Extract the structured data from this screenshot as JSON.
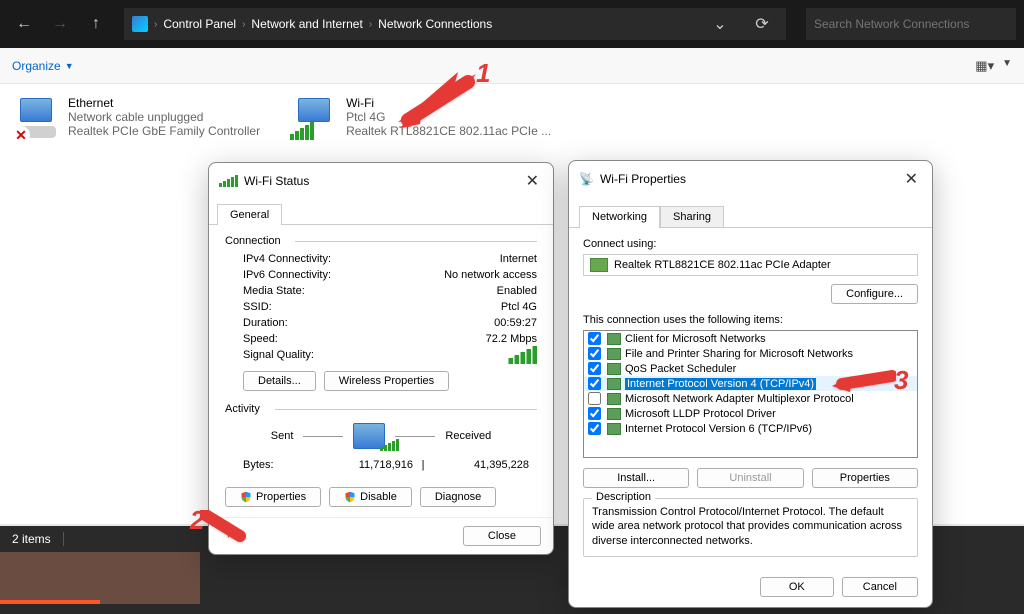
{
  "breadcrumbs": [
    "Control Panel",
    "Network and Internet",
    "Network Connections"
  ],
  "search_placeholder": "Search Network Connections",
  "toolbar": {
    "organize": "Organize"
  },
  "adapters": {
    "ethernet": {
      "name": "Ethernet",
      "status": "Network cable unplugged",
      "device": "Realtek PCIe GbE Family Controller"
    },
    "wifi": {
      "name": "Wi-Fi",
      "status": "Ptcl 4G",
      "device": "Realtek RTL8821CE 802.11ac PCIe ..."
    }
  },
  "annotations": {
    "a1": "1",
    "a2": "2",
    "a3": "3"
  },
  "status_bar": {
    "count": "2 items"
  },
  "status_dialog": {
    "title": "Wi-Fi Status",
    "tab_general": "General",
    "group_connection": "Connection",
    "group_activity": "Activity",
    "rows": {
      "ipv4_l": "IPv4 Connectivity:",
      "ipv4_v": "Internet",
      "ipv6_l": "IPv6 Connectivity:",
      "ipv6_v": "No network access",
      "media_l": "Media State:",
      "media_v": "Enabled",
      "ssid_l": "SSID:",
      "ssid_v": "Ptcl 4G",
      "dur_l": "Duration:",
      "dur_v": "00:59:27",
      "speed_l": "Speed:",
      "speed_v": "72.2 Mbps",
      "signal_l": "Signal Quality:"
    },
    "buttons": {
      "details": "Details...",
      "wprops": "Wireless Properties"
    },
    "activity": {
      "sent": "Sent",
      "received": "Received",
      "bytes_l": "Bytes:",
      "bytes_sent": "11,718,916",
      "bytes_recv": "41,395,228"
    },
    "footer": {
      "props": "Properties",
      "disable": "Disable",
      "diagnose": "Diagnose",
      "close": "Close"
    }
  },
  "props_dialog": {
    "title": "Wi-Fi Properties",
    "tab_networking": "Networking",
    "tab_sharing": "Sharing",
    "connect_using": "Connect using:",
    "adapter": "Realtek RTL8821CE 802.11ac PCIe Adapter",
    "configure": "Configure...",
    "items_label": "This connection uses the following items:",
    "items": [
      {
        "checked": true,
        "text": "Client for Microsoft Networks"
      },
      {
        "checked": true,
        "text": "File and Printer Sharing for Microsoft Networks"
      },
      {
        "checked": true,
        "text": "QoS Packet Scheduler"
      },
      {
        "checked": true,
        "text": "Internet Protocol Version 4 (TCP/IPv4)",
        "selected": true
      },
      {
        "checked": false,
        "text": "Microsoft Network Adapter Multiplexor Protocol"
      },
      {
        "checked": true,
        "text": "Microsoft LLDP Protocol Driver"
      },
      {
        "checked": true,
        "text": "Internet Protocol Version 6 (TCP/IPv6)"
      }
    ],
    "btn_install": "Install...",
    "btn_uninstall": "Uninstall",
    "btn_props": "Properties",
    "desc_label": "Description",
    "desc_text": "Transmission Control Protocol/Internet Protocol. The default wide area network protocol that provides communication across diverse interconnected networks.",
    "ok": "OK",
    "cancel": "Cancel"
  }
}
